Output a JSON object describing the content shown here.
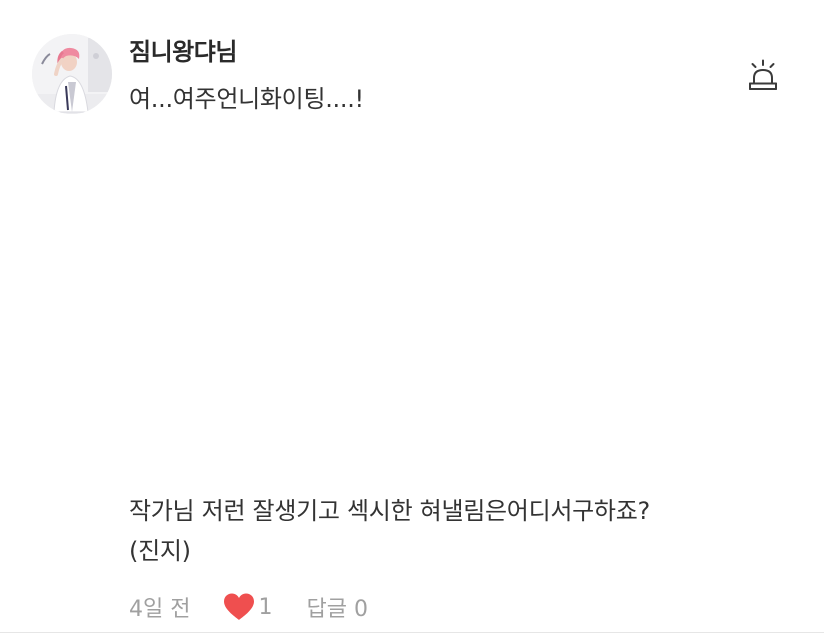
{
  "comment": {
    "username": "짐니왕댜님",
    "first_line": "여...여주언니화이팅....!",
    "body_lines": [
      "작가님 저런 잘생기고 섹시한 혀낼림은어디서구하죠?",
      "(진지)"
    ],
    "timestamp": "4일 전",
    "like_count": "1",
    "reply_label": "답글",
    "reply_count": "0"
  },
  "icons": {
    "report": "siren-icon",
    "like": "heart-icon"
  },
  "colors": {
    "heart": "#ef4f4f",
    "meta_text": "#a0a0a0",
    "body_text": "#333333"
  }
}
